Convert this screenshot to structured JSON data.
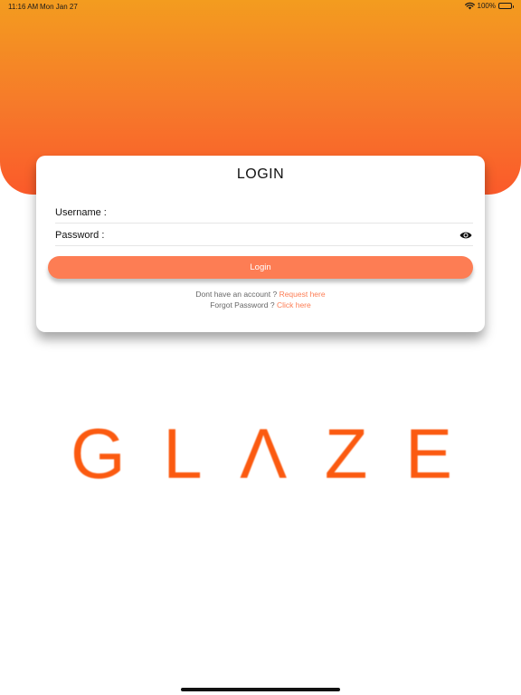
{
  "status_bar": {
    "time": "11:16 AM",
    "date": "Mon Jan 27",
    "battery": "100%",
    "wifi_icon": "wifi-icon",
    "battery_icon": "battery-icon"
  },
  "login": {
    "title": "LOGIN",
    "username_label": "Username :",
    "username_value": "",
    "password_label": "Password :",
    "password_value": "",
    "show_password_icon": "eye-icon",
    "button_label": "Login",
    "signup_prompt": "Dont have an account ?",
    "signup_link": "Request here",
    "forgot_prompt": "Forgot Password ?",
    "forgot_link": "Click here"
  },
  "logo": {
    "letters": [
      "G",
      "L",
      "Λ",
      "Z",
      "E"
    ],
    "color": "#fb5a10"
  },
  "colors": {
    "gradient_top": "#f39c1f",
    "gradient_bottom": "#fb5a2a",
    "accent": "#fd7d54"
  }
}
